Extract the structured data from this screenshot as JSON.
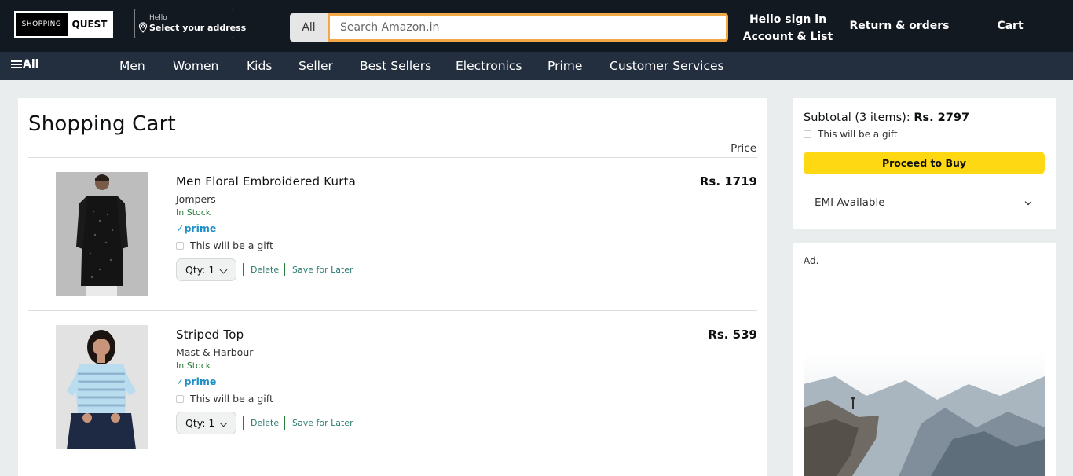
{
  "header": {
    "logo_left": "SHOPPING",
    "logo_right": "QUEST",
    "address_hello": "Hello",
    "address_select": "Select your address",
    "search_category": "All",
    "search_placeholder": "Search Amazon.in",
    "signin_line1": "Hello sign in",
    "signin_line2": "Account & List",
    "returns": "Return & orders",
    "cart": "Cart"
  },
  "nav": {
    "all": "All",
    "items": [
      "Men",
      "Women",
      "Kids",
      "Seller",
      "Best Sellers",
      "Electronics",
      "Prime",
      "Customer Services"
    ]
  },
  "cart": {
    "title": "Shopping Cart",
    "price_header": "Price",
    "items": [
      {
        "name": "Men Floral Embroidered Kurta",
        "brand": "Jompers",
        "stock": "In Stock",
        "prime": "✓prime",
        "gift": "This will be a gift",
        "qty": "Qty: 1",
        "delete": "Delete",
        "save": "Save for Later",
        "price": "Rs. 1719"
      },
      {
        "name": "Striped Top",
        "brand": "Mast & Harbour",
        "stock": "In Stock",
        "prime": "✓prime",
        "gift": "This will be a gift",
        "qty": "Qty: 1",
        "delete": "Delete",
        "save": "Save for Later",
        "price": "Rs. 539"
      }
    ]
  },
  "summary": {
    "subtotal_label": "Subtotal (3 items):",
    "subtotal_value": "Rs. 2797",
    "gift": "This will be a gift",
    "buy_button": "Proceed to Buy",
    "emi": "EMI Available"
  },
  "ad": {
    "label": "Ad."
  },
  "colors": {
    "header_bg": "#131921",
    "nav_bg": "#232f3e",
    "search_border": "#f3a847",
    "buy_button": "#ffd814",
    "prime": "#1e90c8",
    "in_stock": "#2a7f3c"
  }
}
